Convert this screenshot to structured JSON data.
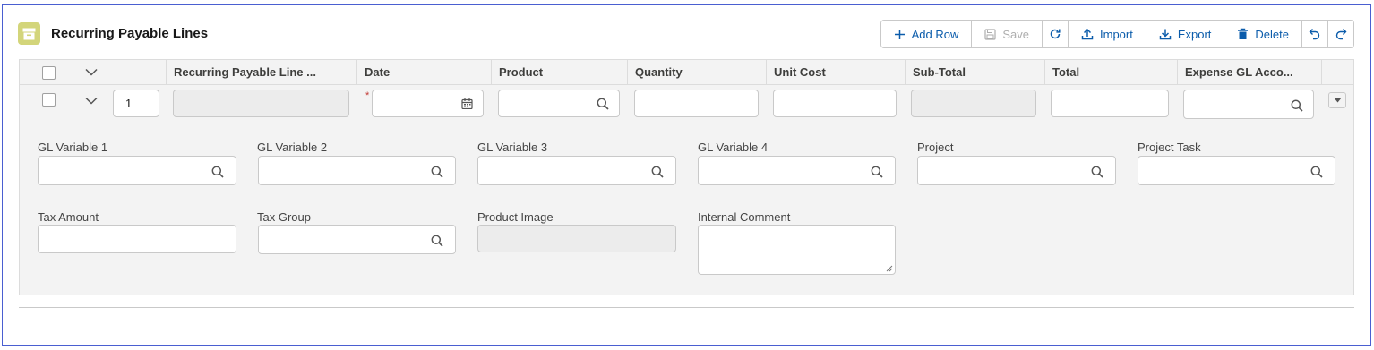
{
  "header": {
    "title": "Recurring Payable Lines",
    "icon": "archive-box-icon",
    "icon_color": "#d3d57a"
  },
  "toolbar": {
    "add_row": "Add Row",
    "save": "Save",
    "import": "Import",
    "export": "Export",
    "delete": "Delete"
  },
  "columns": [
    "Recurring Payable Line ...",
    "Date",
    "Product",
    "Quantity",
    "Unit Cost",
    "Sub-Total",
    "Total",
    "Expense GL Acco..."
  ],
  "row": {
    "index": "1"
  },
  "detail_fields": {
    "gl_variable_1": "GL Variable 1",
    "gl_variable_2": "GL Variable 2",
    "gl_variable_3": "GL Variable 3",
    "gl_variable_4": "GL Variable 4",
    "project": "Project",
    "project_task": "Project Task",
    "tax_amount": "Tax Amount",
    "tax_group": "Tax Group",
    "product_image": "Product Image",
    "internal_comment": "Internal Comment"
  },
  "colors": {
    "link": "#0b5cab",
    "required": "#c23934",
    "frame_border": "#4a5fd1"
  }
}
